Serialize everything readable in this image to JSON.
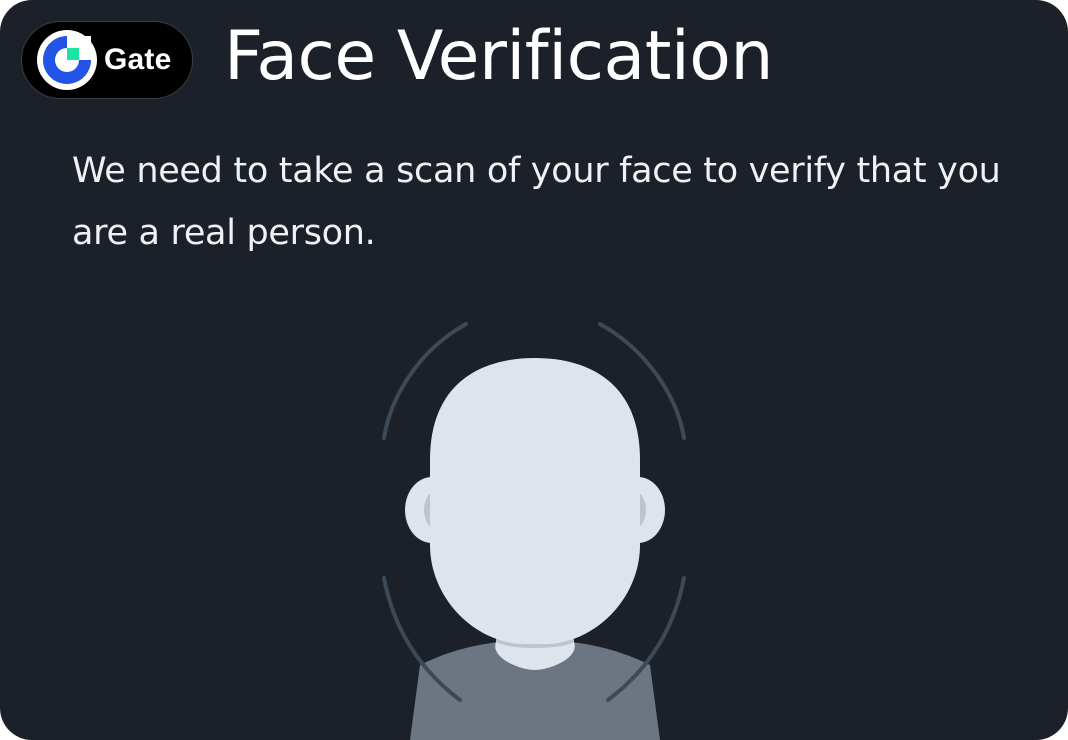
{
  "brand": {
    "name": "Gate",
    "logo_icon": "gate-logo-icon",
    "logo_colors": {
      "ring": "#2354e6",
      "square": "#17e5a1",
      "pill": "#000000"
    }
  },
  "header": {
    "title": "Face Verification"
  },
  "body": {
    "description": "We need to take a scan of your face to verify that you are a real person."
  },
  "illustration": {
    "icon": "face-scan-icon",
    "colors": {
      "background": "#1b2029",
      "head": "#dde4ec",
      "ear_inner": "#bcc4ce",
      "neck_shadow": "#bcc4ce",
      "shirt": "#6c7682",
      "scan_arcs": "#3d4956"
    }
  }
}
